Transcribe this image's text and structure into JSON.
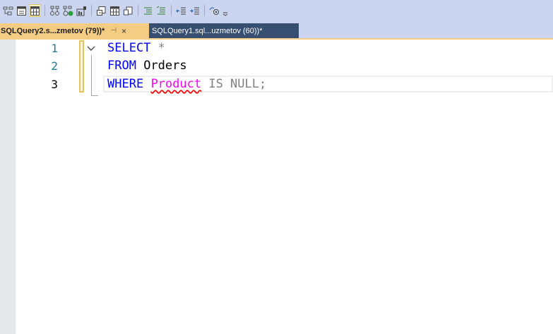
{
  "toolbar": {
    "buttons": [
      {
        "icon": "parse-icon",
        "active": false
      },
      {
        "icon": "results-to-text-icon",
        "active": false
      },
      {
        "icon": "results-to-grid-icon",
        "active": true
      },
      {
        "icon": "display-estimated-plan-icon",
        "active": false
      },
      {
        "icon": "include-actual-plan-icon",
        "active": false
      },
      {
        "icon": "include-live-statistics-icon",
        "active": false
      },
      {
        "icon": "results-to-file-icon",
        "active": false
      },
      {
        "icon": "query-options-icon",
        "active": false
      },
      {
        "icon": "comment-icon",
        "active": false
      },
      {
        "icon": "uncomment-icon",
        "active": false
      },
      {
        "icon": "decrease-indent-icon",
        "active": false
      },
      {
        "icon": "increase-indent-icon",
        "active": false
      },
      {
        "icon": "specify-template-values-icon",
        "active": false
      }
    ]
  },
  "tabs": [
    {
      "label": "SQLQuery2.s...zmetov (79))*",
      "pin": "⊣",
      "close": "×",
      "active": true
    },
    {
      "label": "SQLQuery1.sql...uzmetov (60))*",
      "active": false
    }
  ],
  "editor": {
    "line_numbers": [
      "1",
      "2",
      "3"
    ],
    "current_line": 3,
    "lines": [
      [
        {
          "text": "SELECT",
          "style": "kw"
        },
        {
          "text": " ",
          "style": "ident"
        },
        {
          "text": "*",
          "style": "gray"
        }
      ],
      [
        {
          "text": "FROM",
          "style": "kw"
        },
        {
          "text": " Orders",
          "style": "ident"
        }
      ],
      [
        {
          "text": "WHERE",
          "style": "kw"
        },
        {
          "text": " ",
          "style": "ident"
        },
        {
          "text": "Product",
          "style": "fn"
        },
        {
          "text": " IS NULL;",
          "style": "gray"
        }
      ]
    ]
  },
  "colors": {
    "keyword": "#0000ff",
    "operator": "#808080",
    "function": "#ff00ff",
    "line_number": "#237893",
    "active_tab": "#f5cc84",
    "inactive_tab": "#364e6f"
  }
}
